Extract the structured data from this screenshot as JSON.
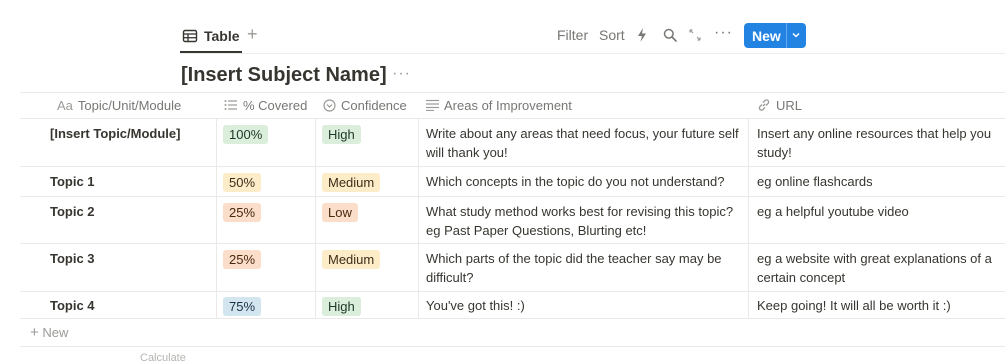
{
  "view": {
    "tab_label": "Table",
    "toolbar": {
      "filter": "Filter",
      "sort": "Sort",
      "new_label": "New"
    }
  },
  "title": "[Insert Subject Name]",
  "columns": [
    {
      "prefix": "Aa",
      "label": "Topic/Unit/Module",
      "icon": "title-icon"
    },
    {
      "label": "% Covered",
      "icon": "list-icon"
    },
    {
      "label": "Confidence",
      "icon": "select-icon"
    },
    {
      "label": "Areas of Improvement",
      "icon": "text-icon"
    },
    {
      "label": "URL",
      "icon": "link-icon"
    }
  ],
  "rows": [
    {
      "topic": "[Insert Topic/Module]",
      "covered": "100%",
      "covered_color": "#dbeddb",
      "confidence": "High",
      "confidence_color": "#dbeddb",
      "improvement": [
        "Write about any areas that need focus, your future self",
        "will thank you!"
      ],
      "url": [
        "Insert any online resources that help you",
        "study!"
      ]
    },
    {
      "topic": "Topic 1",
      "covered": "50%",
      "covered_color": "#fdecc8",
      "confidence": "Medium",
      "confidence_color": "#fdecc8",
      "improvement": [
        "Which concepts in the topic do you not understand?"
      ],
      "url": [
        "eg online flashcards"
      ]
    },
    {
      "topic": "Topic 2",
      "covered": "25%",
      "covered_color": "#fadec9",
      "confidence": "Low",
      "confidence_color": "#fadec9",
      "improvement": [
        "What study method works best for revising this topic?",
        "eg Past Paper Questions, Blurting etc!"
      ],
      "url": [
        "eg a helpful youtube video"
      ]
    },
    {
      "topic": "Topic 3",
      "covered": "25%",
      "covered_color": "#fadec9",
      "confidence": "Medium",
      "confidence_color": "#fdecc8",
      "improvement": [
        "Which parts of the topic did the teacher say may be",
        "difficult?"
      ],
      "url": [
        "eg a website with great explanations of a",
        "certain concept"
      ]
    },
    {
      "topic": "Topic 4",
      "covered": "75%",
      "covered_color": "#d3e5ef",
      "confidence": "High",
      "confidence_color": "#dbeddb",
      "improvement": [
        "You've got this! :)"
      ],
      "url": [
        "Keep going! It will all be worth it :)"
      ]
    }
  ],
  "new_row_label": "New",
  "calculate_label": "Calculate"
}
